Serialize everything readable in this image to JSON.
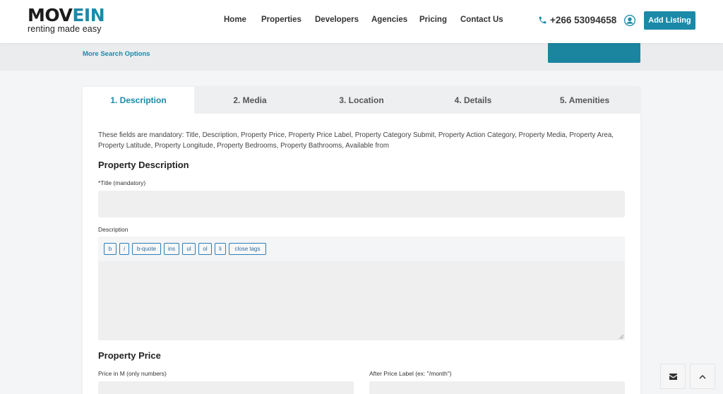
{
  "header": {
    "logo_prefix": "MOV",
    "logo_accent": "EIN",
    "logo_tagline": "renting made easy",
    "nav": [
      "Home",
      "Properties",
      "Developers",
      "Agencies",
      "Pricing",
      "Contact Us"
    ],
    "phone": "+266 53094658",
    "add_listing": "Add Listing"
  },
  "search": {
    "more_options": "More Search Options"
  },
  "tabs": [
    "1. Description",
    "2. Media",
    "3. Location",
    "4. Details",
    "5. Amenities"
  ],
  "form": {
    "mandatory_note": "These fields are mandatory: Title, Description, Property Price, Property Price Label, Property Category Submit, Property Action Category, Property Media, Property Area, Property Latitude, Property Longitude, Property Bedrooms, Property Bathrooms, Available from",
    "description_section": "Property Description",
    "title_label": "*Title (mandatory)",
    "title_value": "",
    "description_label": "Description",
    "editor_buttons": [
      "b",
      "i",
      "b-quote",
      "ins",
      "ul",
      "ol",
      "li",
      "close tags"
    ],
    "price_section": "Property Price",
    "price_label": "Price in M (only numbers)",
    "after_price_label": "After Price Label (ex: \"/month\")"
  },
  "colors": {
    "accent": "#1b8aa8",
    "text": "#333333",
    "input_bg": "#efefef"
  },
  "icons": [
    "phone-icon",
    "user-icon",
    "envelope-icon",
    "chevron-up-icon"
  ]
}
